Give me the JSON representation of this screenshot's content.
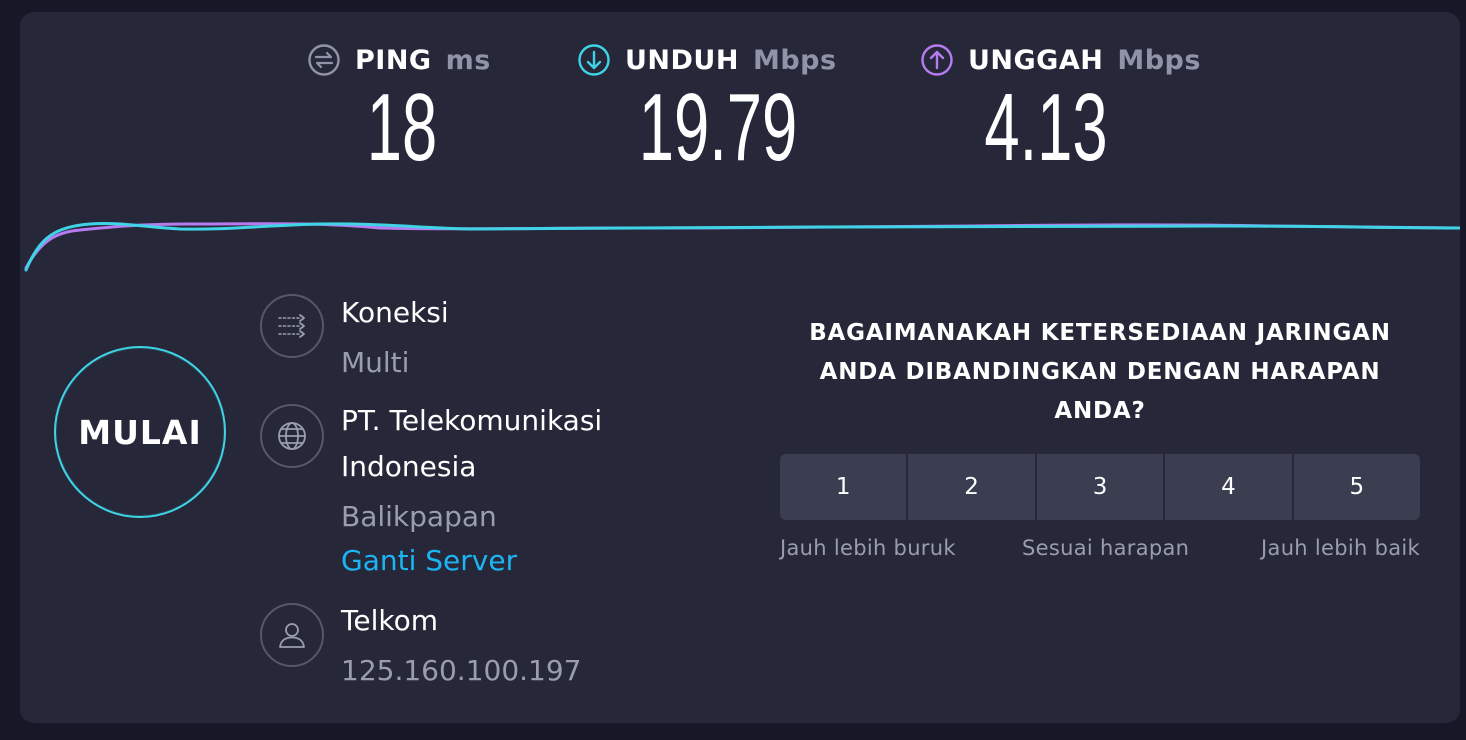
{
  "metrics": {
    "ping": {
      "label": "PING",
      "unit": "ms",
      "value": "18",
      "icon": "ping-icon"
    },
    "download": {
      "label": "UNDUH",
      "unit": "Mbps",
      "value": "19.79",
      "icon": "download-arrow-icon"
    },
    "upload": {
      "label": "UNGGAH",
      "unit": "Mbps",
      "value": "4.13",
      "icon": "upload-arrow-icon"
    }
  },
  "colors": {
    "background": "#171827",
    "panel": "#262839",
    "ping": "#9193a8",
    "download": "#3fd3e6",
    "upload": "#b77bf0",
    "link": "#1ab5f2",
    "rating_button": "#3b3d51"
  },
  "start_button": {
    "label": "MULAI"
  },
  "connection": {
    "title": "Koneksi",
    "value": "Multi",
    "icon": "connections-icon"
  },
  "server": {
    "name_line1": "PT. Telekomunikasi",
    "name_line2": "Indonesia",
    "location": "Balikpapan",
    "change_link": "Ganti Server",
    "icon": "globe-icon"
  },
  "provider": {
    "name": "Telkom",
    "ip": "125.160.100.197",
    "icon": "user-icon"
  },
  "survey": {
    "question_line1": "BAGAIMANAKAH KETERSEDIAAN JARINGAN",
    "question_line2": "ANDA DIBANDINGKAN DENGAN HARAPAN",
    "question_line3": "ANDA?",
    "options": [
      "1",
      "2",
      "3",
      "4",
      "5"
    ],
    "label_low": "Jauh lebih buruk",
    "label_mid": "Sesuai harapan",
    "label_high": "Jauh lebih baik"
  }
}
